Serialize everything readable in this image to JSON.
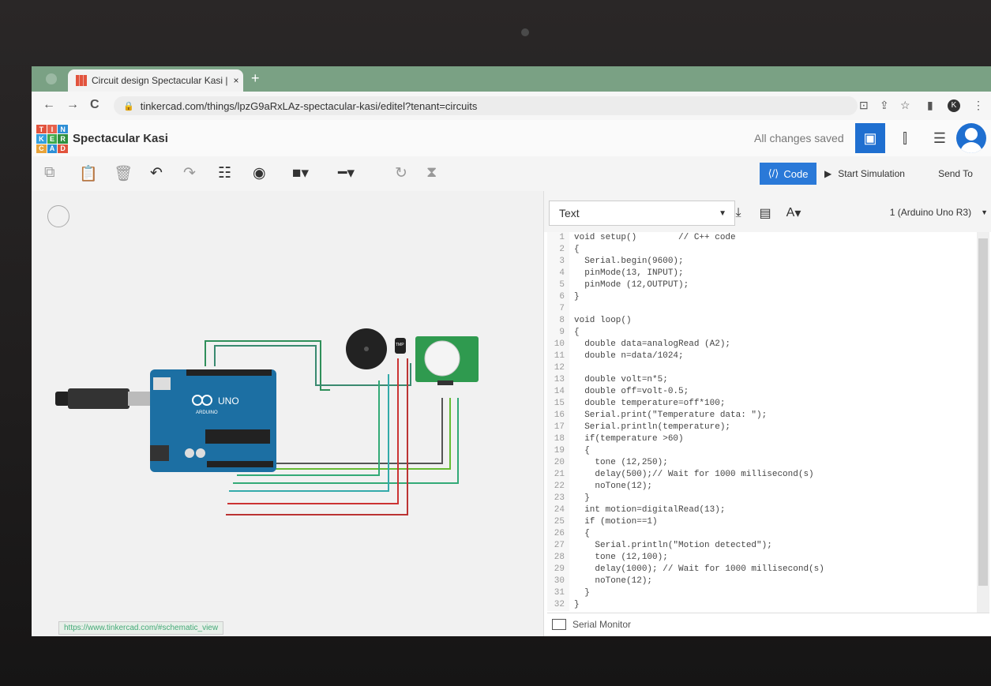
{
  "browser": {
    "tab_title": "Circuit design Spectacular Kasi | T",
    "tab_close": "×",
    "new_tab": "+",
    "url": "tinkercad.com/things/lpzG9aRxLAz-spectacular-kasi/editel?tenant=circuits",
    "status_url": "https://www.tinkercad.com/#schematic_view",
    "profile_initial": "K"
  },
  "header": {
    "logo_letters": [
      "T",
      "I",
      "N",
      "K",
      "E",
      "R",
      "C",
      "A",
      "D"
    ],
    "project_name": "Spectacular Kasi",
    "save_status": "All changes saved"
  },
  "toolbar": {
    "code_label": "Code",
    "start_simulation_label": "Start Simulation",
    "send_to_label": "Send To"
  },
  "code_panel": {
    "mode": "Text",
    "device": "1 (Arduino Uno R3)",
    "font_label": "A",
    "serial_monitor_label": "Serial Monitor",
    "lines": [
      "void setup()        // C++ code",
      "{",
      "  Serial.begin(9600);",
      "  pinMode(13, INPUT);",
      "  pinMode (12,OUTPUT);",
      "}",
      "",
      "void loop()",
      "{",
      "  double data=analogRead (A2);",
      "  double n=data/1024;",
      "",
      "  double volt=n*5;",
      "  double off=volt-0.5;",
      "  double temperature=off*100;",
      "  Serial.print(\"Temperature data: \");",
      "  Serial.println(temperature);",
      "  if(temperature >60)",
      "  {",
      "    tone (12,250);",
      "    delay(500);// Wait for 1000 millisecond(s)",
      "    noTone(12);",
      "  }",
      "  int motion=digitalRead(13);",
      "  if (motion==1)",
      "  {",
      "    Serial.println(\"Motion detected\");",
      "    tone (12,100);",
      "    delay(1000); // Wait for 1000 millisecond(s)",
      "    noTone(12);",
      "  }",
      "}"
    ]
  },
  "circuit": {
    "board_label": "UNO",
    "board_brand": "ARDUINO",
    "sensor_label": "TMP"
  },
  "colors": {
    "accent": "#2a79d8",
    "board": "#1c6fa3",
    "tabbar": "#7aa184"
  }
}
